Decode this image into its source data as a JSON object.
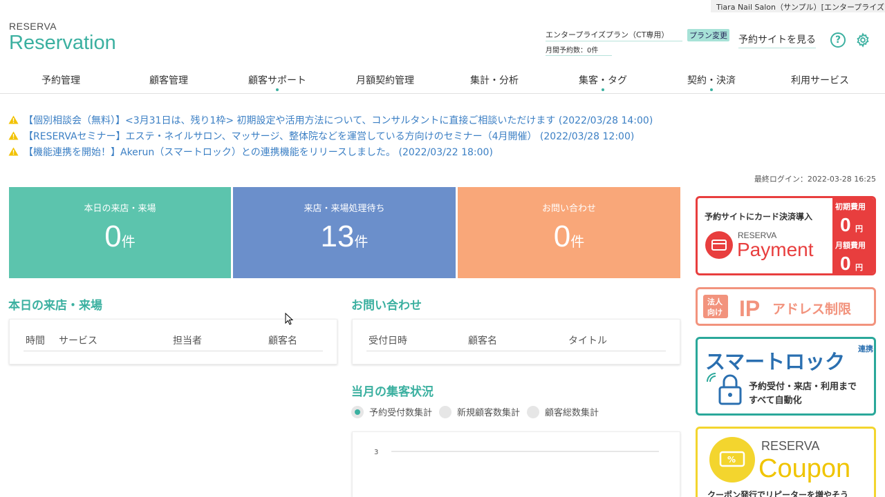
{
  "window": {
    "salon_tab": "Tiara Nail Salon（サンプル）[エンタープライズ"
  },
  "logo": {
    "small": "RESERVA",
    "big": "Reservation"
  },
  "header": {
    "plan_name": "エンタープライズプラン（CT専用）",
    "monthly_bookings": "月間予約数：0件",
    "plan_change_button": "プラン変更",
    "site_link": "予約サイトを見る",
    "help_symbol": "?"
  },
  "nav": [
    {
      "label": "予約管理",
      "dot": false
    },
    {
      "label": "顧客管理",
      "dot": false
    },
    {
      "label": "顧客サポート",
      "dot": true
    },
    {
      "label": "月額契約管理",
      "dot": false
    },
    {
      "label": "集計・分析",
      "dot": false
    },
    {
      "label": "集客・タグ",
      "dot": true
    },
    {
      "label": "契約・決済",
      "dot": true
    },
    {
      "label": "利用サービス",
      "dot": false
    }
  ],
  "news": [
    "【個別相談会（無料）】<3月31日は、残り1枠> 初期設定や活用方法について、コンサルタントに直接ご相談いただけます (2022/03/28 14:00)",
    "【RESERVAセミナー】エステ・ネイルサロン、マッサージ、整体院などを運営している方向けのセミナー（4月開催） (2022/03/28 12:00)",
    "【機能連携を開始！】Akerun（スマートロック）との連携機能をリリースしました。 (2022/03/22 18:00)"
  ],
  "last_login": "最終ログイン：2022-03-28 16:25",
  "stats": [
    {
      "label": "本日の来店・来場",
      "value": "0",
      "unit": "件",
      "color": "#5cc4ad"
    },
    {
      "label": "来店・来場処理待ち",
      "value": "13",
      "unit": "件",
      "color": "#6b8fcb"
    },
    {
      "label": "お問い合わせ",
      "value": "0",
      "unit": "件",
      "color": "#f9a779"
    }
  ],
  "today_visits": {
    "title": "本日の来店・来場",
    "columns": [
      "時間",
      "サービス",
      "担当者",
      "顧客名"
    ]
  },
  "inquiries": {
    "title": "お問い合わせ",
    "columns": [
      "受付日時",
      "顧客名",
      "タイトル"
    ]
  },
  "monthly": {
    "title": "当月の集客状況",
    "radios": [
      {
        "label": "予約受付数集計",
        "checked": true
      },
      {
        "label": "新規顧客数集計",
        "checked": false
      },
      {
        "label": "顧客総数集計",
        "checked": false
      }
    ],
    "y_tick": "3"
  },
  "banners": {
    "payment": {
      "headline": "予約サイトにカード決済導入",
      "brand_small": "RESERVA",
      "brand_big": "Payment",
      "initial_label": "初期費用",
      "initial_value": "0",
      "monthly_label": "月額費用",
      "monthly_value": "0",
      "yen": "円"
    },
    "ip": {
      "tag_line1": "法人",
      "tag_line2": "向け",
      "ip": "IP",
      "text": "アドレス制限"
    },
    "smartlock": {
      "title": "スマートロック",
      "tag": "連携",
      "line1": "予約受付・来店・利用まで",
      "line2": "すべて自動化"
    },
    "coupon": {
      "brand_small": "RESERVA",
      "brand_big": "Coupon",
      "symbol": "%",
      "footer": "クーポン発行でリピーターを増やそう"
    }
  },
  "colors": {
    "accent": "#3bb0a0",
    "news_link": "#3b7fc4",
    "warning": "#f2c200"
  }
}
